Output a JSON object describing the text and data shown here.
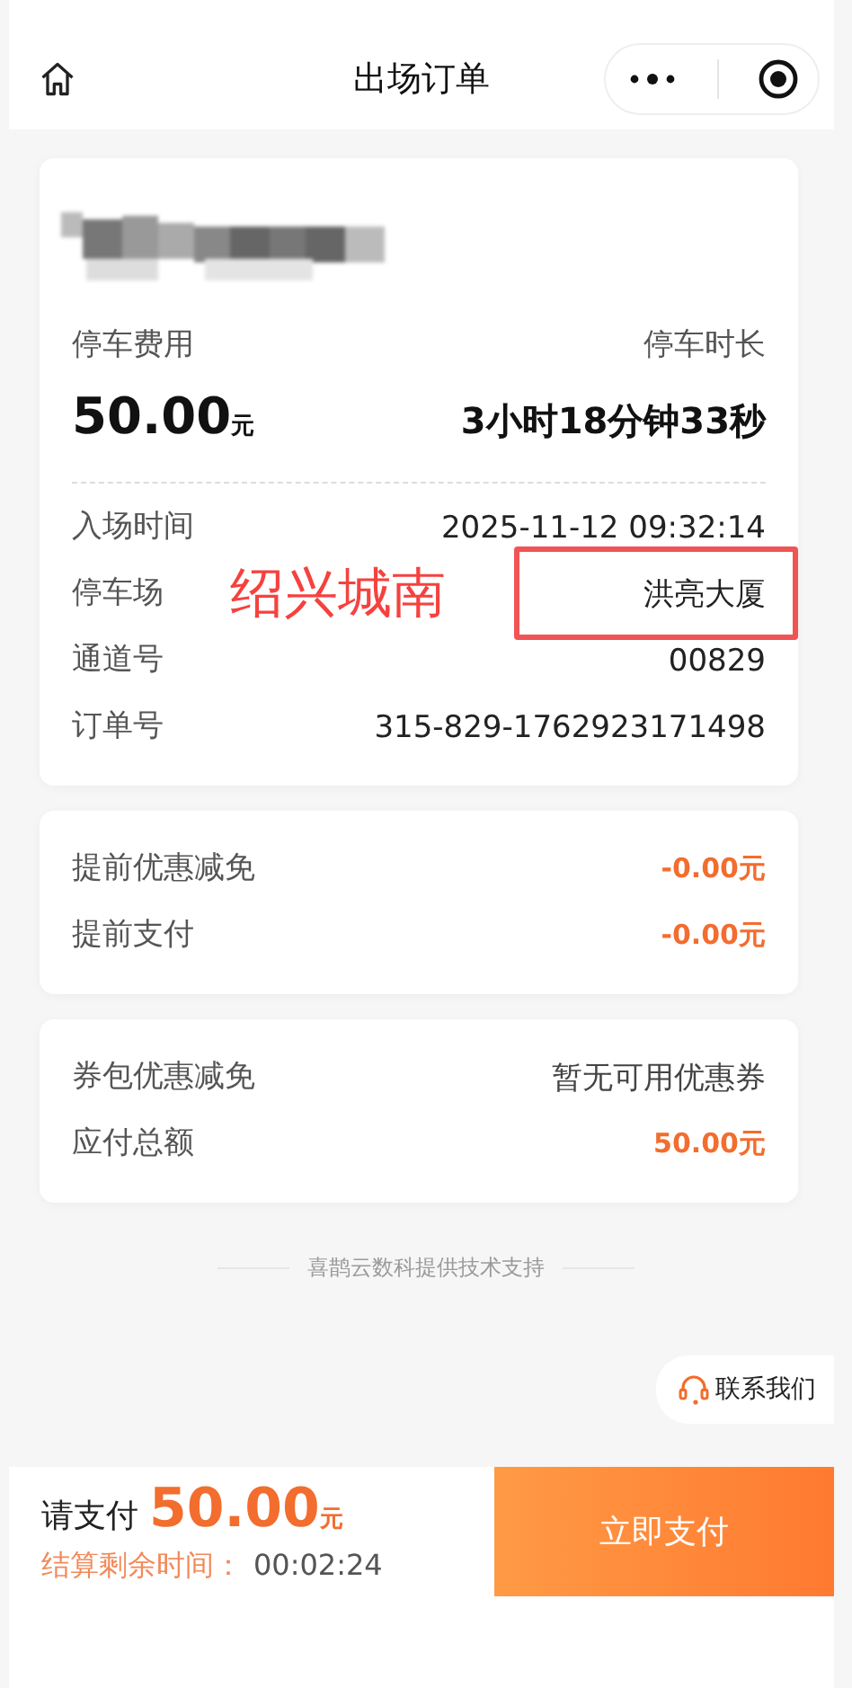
{
  "nav": {
    "title": "出场订单"
  },
  "summary": {
    "fee_label": "停车费用",
    "fee_amount": "50.00",
    "fee_unit": "元",
    "duration_label": "停车时长",
    "duration": "3小时18分钟33秒"
  },
  "details": [
    {
      "label": "入场时间",
      "value": "2025-11-12 09:32:14",
      "framed": false
    },
    {
      "label": "停车场",
      "value": "洪亮大厦",
      "framed": true,
      "note": "绍兴城南"
    },
    {
      "label": "通道号",
      "value": "00829",
      "framed": false
    },
    {
      "label": "订单号",
      "value": "315-829-1762923171498",
      "framed": false
    }
  ],
  "discounts": [
    {
      "label": "提前优惠减免",
      "value": "-0.00元",
      "kind": "amount"
    },
    {
      "label": "提前支付",
      "value": "-0.00元",
      "kind": "amount"
    }
  ],
  "totals": [
    {
      "label": "券包优惠减免",
      "value": "暂无可用优惠券",
      "kind": "plain"
    },
    {
      "label": "应付总额",
      "value": "50.00元",
      "kind": "amount"
    }
  ],
  "footer": "喜鹊云数科提供技术支持",
  "contact": "联系我们",
  "pay_bar": {
    "prompt": "请支付",
    "amount": "50.00",
    "unit": "元",
    "countdown_label": "结算剩余时间：",
    "countdown": "00:02:24",
    "button": "立即支付"
  }
}
